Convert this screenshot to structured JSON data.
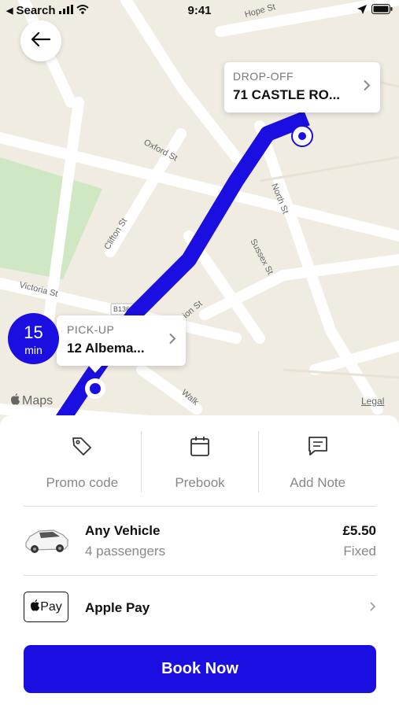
{
  "status_bar": {
    "back_app": "Search",
    "time": "9:41"
  },
  "map": {
    "street_labels": [
      "Hope St",
      "Oxford St",
      "North St",
      "Sussex St",
      "Clifton St",
      "Victoria St",
      "B1364",
      "Walk",
      "ion St"
    ],
    "route_color": "#1a0fe0",
    "attribution": "Maps",
    "legal": "Legal"
  },
  "dropoff": {
    "caption": "DROP-OFF",
    "address": "71 CASTLE RO..."
  },
  "pickup": {
    "caption": "PICK-UP",
    "address": "12 Albema...",
    "eta_value": "15",
    "eta_unit": "min"
  },
  "options": [
    {
      "label": "Promo code",
      "icon": "tag-icon"
    },
    {
      "label": "Prebook",
      "icon": "calendar-icon"
    },
    {
      "label": "Add Note",
      "icon": "note-icon"
    }
  ],
  "vehicle": {
    "name": "Any Vehicle",
    "passengers": "4 passengers",
    "price": "£5.50",
    "price_type": "Fixed"
  },
  "payment": {
    "badge": "Pay",
    "label": "Apple Pay"
  },
  "book_button": "Book Now",
  "colors": {
    "accent": "#1a0fe0",
    "map_background": "#f1ece2",
    "park": "#cfe7c2"
  }
}
